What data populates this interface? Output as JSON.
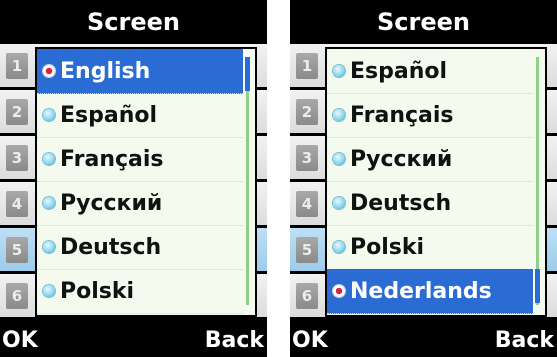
{
  "screens": [
    {
      "title": "Screen",
      "background_numbers": [
        "1",
        "2",
        "3",
        "4",
        "5",
        "6"
      ],
      "items": [
        {
          "label": "English",
          "selected": true
        },
        {
          "label": "Español",
          "selected": false
        },
        {
          "label": "Français",
          "selected": false
        },
        {
          "label": "Русский",
          "selected": false
        },
        {
          "label": "Deutsch",
          "selected": false
        },
        {
          "label": "Polski",
          "selected": false
        }
      ],
      "softkey_left": "OK",
      "softkey_right": "Back"
    },
    {
      "title": "Screen",
      "background_numbers": [
        "1",
        "2",
        "3",
        "4",
        "5",
        "6"
      ],
      "items": [
        {
          "label": "Español",
          "selected": false
        },
        {
          "label": "Français",
          "selected": false
        },
        {
          "label": "Русский",
          "selected": false
        },
        {
          "label": "Deutsch",
          "selected": false
        },
        {
          "label": "Polski",
          "selected": false
        },
        {
          "label": "Nederlands",
          "selected": true
        }
      ],
      "softkey_left": "OK",
      "softkey_right": "Back"
    }
  ],
  "colors": {
    "selection": "#2b6bd4",
    "popup_bg": "#f4fbee",
    "scrollbar": "#8fd08a"
  }
}
